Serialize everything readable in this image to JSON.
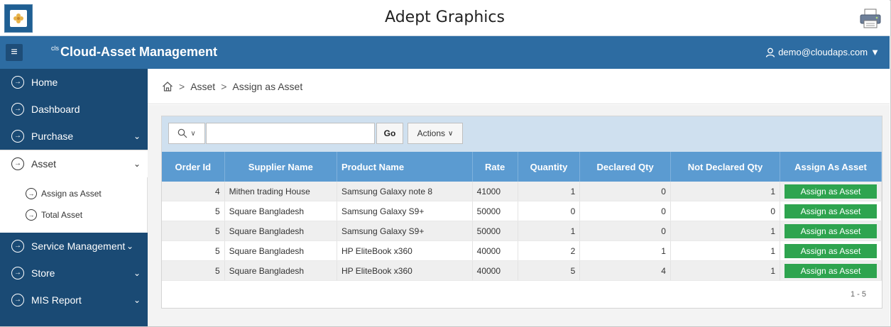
{
  "app": {
    "title": "Adept Graphics",
    "brand_prefix": "cls",
    "brand": "Cloud-Asset Management",
    "user": "demo@cloudaps.com"
  },
  "sidebar": {
    "items": [
      {
        "label": "Home"
      },
      {
        "label": "Dashboard"
      },
      {
        "label": "Purchase"
      },
      {
        "label": "Asset"
      },
      {
        "label": "Service Management"
      },
      {
        "label": "Store"
      },
      {
        "label": "MIS Report"
      }
    ],
    "asset_sub": [
      {
        "label": "Assign as Asset"
      },
      {
        "label": "Total Asset"
      }
    ]
  },
  "breadcrumb": {
    "sep": ">",
    "items": [
      "Asset",
      "Assign as Asset"
    ]
  },
  "toolbar": {
    "search_value": "",
    "go_label": "Go",
    "actions_label": "Actions"
  },
  "table": {
    "headers": [
      "Order Id",
      "Supplier Name",
      "Product Name",
      "Rate",
      "Quantity",
      "Declared Qty",
      "Not Declared Qty",
      "Assign As Asset"
    ],
    "rows": [
      {
        "order_id": "4",
        "supplier": "Mithen trading House",
        "product": "Samsung Galaxy note 8",
        "rate": "41000",
        "qty": "1",
        "declared": "0",
        "not_declared": "1",
        "action": "Assign as Asset"
      },
      {
        "order_id": "5",
        "supplier": "Square Bangladesh",
        "product": "Samsung Galaxy S9+",
        "rate": "50000",
        "qty": "0",
        "declared": "0",
        "not_declared": "0",
        "action": "Assign as Asset"
      },
      {
        "order_id": "5",
        "supplier": "Square Bangladesh",
        "product": "Samsung Galaxy S9+",
        "rate": "50000",
        "qty": "1",
        "declared": "0",
        "not_declared": "1",
        "action": "Assign as Asset"
      },
      {
        "order_id": "5",
        "supplier": "Square Bangladesh",
        "product": "HP EliteBook x360",
        "rate": "40000",
        "qty": "2",
        "declared": "1",
        "not_declared": "1",
        "action": "Assign as Asset"
      },
      {
        "order_id": "5",
        "supplier": "Square Bangladesh",
        "product": "HP EliteBook x360",
        "rate": "40000",
        "qty": "5",
        "declared": "4",
        "not_declared": "1",
        "action": "Assign as Asset"
      }
    ]
  },
  "pager": "1 - 5",
  "colors": {
    "topnav": "#2d6ca2",
    "sidebar": "#1a4a74",
    "table_header": "#5b9bd1",
    "assign_button": "#2ea44f",
    "toolbar": "#cfe0ef"
  }
}
